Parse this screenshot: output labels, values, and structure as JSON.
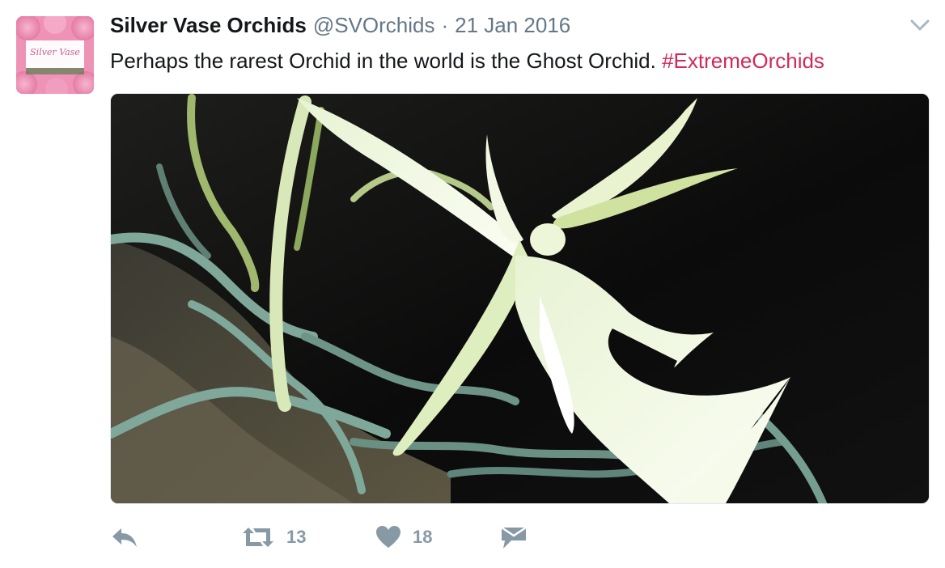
{
  "tweet": {
    "author_name": "Silver Vase Orchids",
    "handle": "@SVOrchids",
    "separator": "·",
    "date": "21 Jan 2016",
    "text": "Perhaps the rarest Orchid in the world is the Ghost Orchid.",
    "hashtag": "#ExtremeOrchids",
    "avatar_text": "Silver Vase",
    "retweet_count": "13",
    "like_count": "18"
  },
  "icons": {
    "menu": "chevron-down-icon",
    "reply": "reply-icon",
    "retweet": "retweet-icon",
    "like": "heart-icon",
    "dm": "envelope-icon"
  },
  "colors": {
    "hashtag": "#d02a5a",
    "muted": "#657786",
    "action": "#8899a6"
  }
}
